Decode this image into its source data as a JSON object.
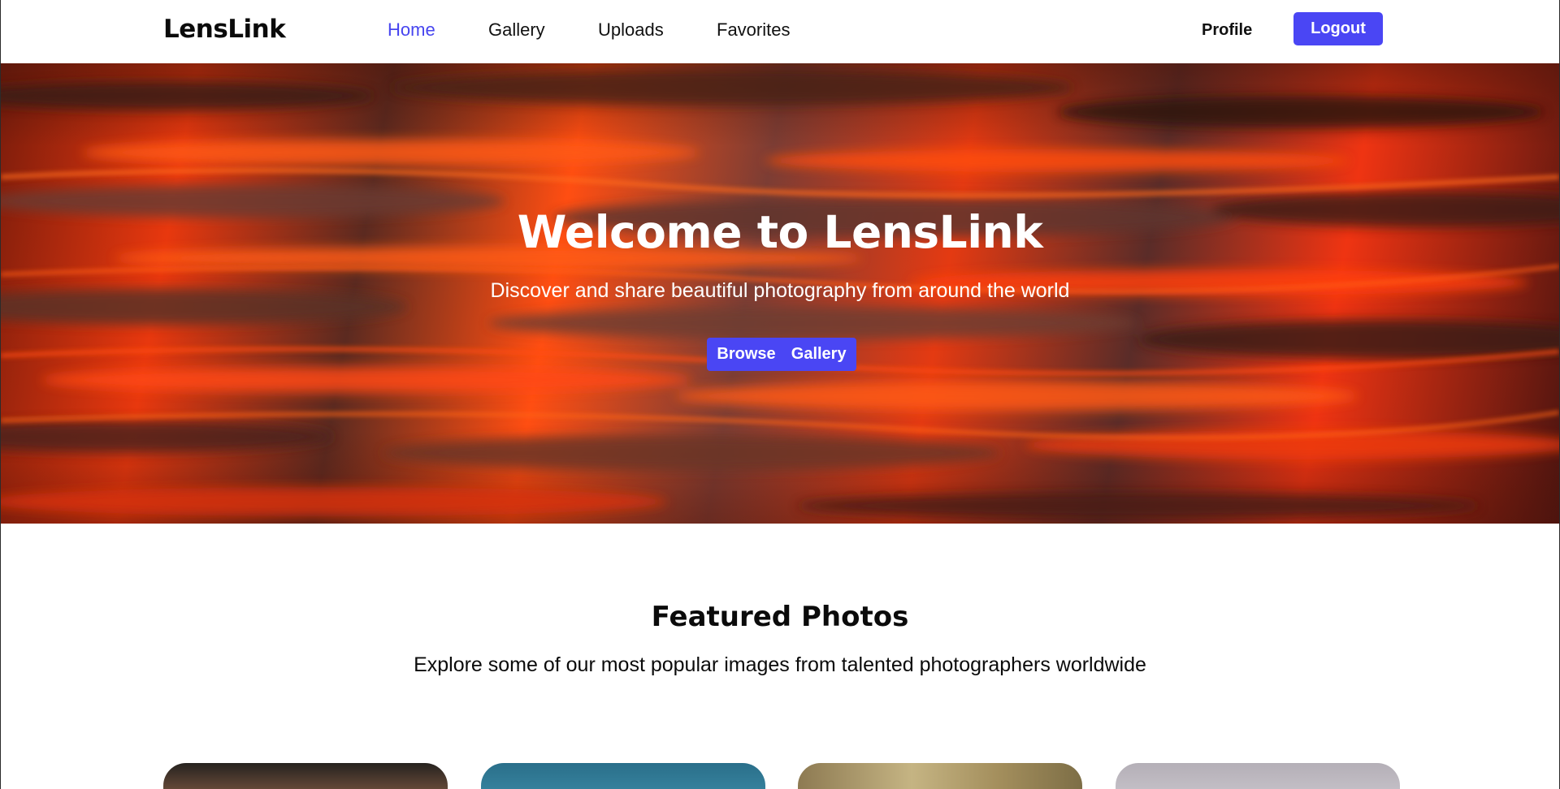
{
  "brand": "LensLink",
  "nav": {
    "items": [
      {
        "label": "Home",
        "active": true
      },
      {
        "label": "Gallery",
        "active": false
      },
      {
        "label": "Uploads",
        "active": false
      },
      {
        "label": "Favorites",
        "active": false
      }
    ],
    "profile_label": "Profile",
    "logout_label": "Logout"
  },
  "hero": {
    "title": "Welcome to LensLink",
    "subtitle": "Discover and share beautiful photography from around the world",
    "cta_label": "Browse  Gallery"
  },
  "featured": {
    "title": "Featured Photos",
    "subtitle": "Explore some of our most popular images from talented photographers worldwide",
    "cards": [
      {
        "name": "featured-photo-1"
      },
      {
        "name": "featured-photo-2"
      },
      {
        "name": "featured-photo-3"
      },
      {
        "name": "featured-photo-4"
      }
    ]
  },
  "colors": {
    "accent": "#4a46f4",
    "active_nav": "#4745ef",
    "hero_sky": "#e8380e"
  }
}
